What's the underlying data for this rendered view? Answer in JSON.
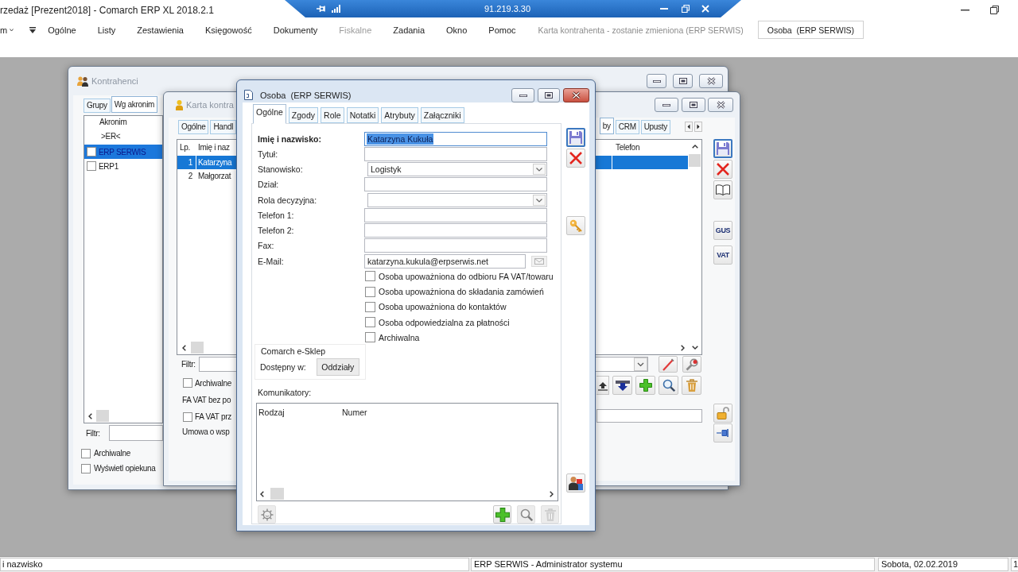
{
  "app": {
    "title": "rzedaż [Prezent2018] - Comarch ERP XL 2018.2.1"
  },
  "remote_bar": {
    "address": "91.219.3.30"
  },
  "menu_bar": {
    "start_menu": "m",
    "items": [
      {
        "label": "Ogólne",
        "disabled": false
      },
      {
        "label": "Listy",
        "disabled": false
      },
      {
        "label": "Zestawienia",
        "disabled": false
      },
      {
        "label": "Księgowość",
        "disabled": false
      },
      {
        "label": "Dokumenty",
        "disabled": false
      },
      {
        "label": "Fiskalne",
        "disabled": true
      },
      {
        "label": "Zadania",
        "disabled": false
      },
      {
        "label": "Okno",
        "disabled": false
      },
      {
        "label": "Pomoc",
        "disabled": false
      }
    ],
    "window_tabs": [
      {
        "label": "Karta kontrahenta - zostanie zmieniona (ERP SERWIS)",
        "selected": false
      },
      {
        "label": "Osoba  (ERP SERWIS)",
        "selected": true
      }
    ]
  },
  "contractors_window": {
    "title": "Kontrahenci",
    "active": false,
    "tabs": [
      {
        "label": "Grupy",
        "selected": false
      },
      {
        "label": "Wg akronim",
        "selected": true
      }
    ],
    "list": {
      "column": "Akronim",
      "filter": ">ER<",
      "rows": [
        {
          "label": "ERP SERWIS",
          "checked": false,
          "selected": true
        },
        {
          "label": "ERP1",
          "checked": false,
          "selected": false
        }
      ]
    },
    "filter_label": "Filtr:",
    "options": [
      {
        "label": "Archiwalne",
        "checked": false
      },
      {
        "label": "Wyświetl opiekuna",
        "checked": false
      }
    ]
  },
  "contractor_card_window": {
    "title": "Karta kontra",
    "active": false,
    "tabs_left": [
      {
        "label": "Ogólne",
        "selected": false
      },
      {
        "label": "Handl",
        "selected": false
      }
    ],
    "tabs_right": [
      {
        "label": "by",
        "selected": true
      },
      {
        "label": "CRM",
        "selected": false
      },
      {
        "label": "Upusty",
        "selected": false
      }
    ],
    "table": {
      "columns": [
        "Lp.",
        "Imię i naz",
        "Telefon"
      ],
      "rows": [
        {
          "number": "1",
          "name": "Katarzyna",
          "selected": true
        },
        {
          "number": "2",
          "name": "Małgorzat",
          "selected": false
        }
      ]
    },
    "filter_label": "Filtr:",
    "options": [
      {
        "kind": "checkbox",
        "label": "Archiwalne",
        "checked": false
      },
      {
        "kind": "text",
        "label": "FA VAT bez po"
      },
      {
        "kind": "checkbox",
        "label": "FA VAT prz",
        "checked": false
      },
      {
        "kind": "text",
        "label": "Umowa o wsp"
      }
    ],
    "lookup_buttons": [
      "GUS",
      "VAT"
    ]
  },
  "person_dialog": {
    "title": "Osoba  (ERP SERWIS)",
    "active": true,
    "tabs": [
      {
        "label": "Ogólne",
        "selected": true
      },
      {
        "label": "Zgody",
        "selected": false
      },
      {
        "label": "Role",
        "selected": false
      },
      {
        "label": "Notatki",
        "selected": false
      },
      {
        "label": "Atrybuty",
        "selected": false
      },
      {
        "label": "Załączniki",
        "selected": false
      }
    ],
    "fields": [
      {
        "label": "Imię i nazwisko:",
        "kind": "text",
        "required": true,
        "text_selected": true,
        "value": "Katarzyna Kukuła"
      },
      {
        "label": "Tytuł:",
        "kind": "text",
        "required": false,
        "text_selected": false
      },
      {
        "label": "Stanowisko:",
        "kind": "dropdown",
        "required": false,
        "text_selected": false,
        "value": "Logistyk"
      },
      {
        "label": "Dział:",
        "kind": "text",
        "required": false,
        "text_selected": false
      },
      {
        "label": "Rola decyzyjna:",
        "kind": "dropdown",
        "required": false,
        "text_selected": false
      },
      {
        "label": "Telefon 1:",
        "kind": "text",
        "required": false,
        "text_selected": false
      },
      {
        "label": "Telefon 2:",
        "kind": "text",
        "required": false,
        "text_selected": false
      },
      {
        "label": "Fax:",
        "kind": "text",
        "required": false,
        "text_selected": false
      },
      {
        "label": "E-Mail:",
        "kind": "email",
        "required": false,
        "text_selected": false,
        "value": "katarzyna.kukula@erpserwis.net"
      }
    ],
    "checkboxes": [
      {
        "label": "Osoba upoważniona do odbioru FA VAT/towaru",
        "checked": false
      },
      {
        "label": "Osoba upoważniona do składania zamówień",
        "checked": false
      },
      {
        "label": "Osoba upoważniona do kontaktów",
        "checked": false
      },
      {
        "label": "Osoba odpowiedzialna za płatności",
        "checked": false
      },
      {
        "label": "Archiwalna",
        "checked": false
      }
    ],
    "eshop": {
      "title": "Comarch e-Sklep",
      "label": "Dostępny w:",
      "button": "Oddziały"
    },
    "messengers": {
      "label": "Komunikatory:",
      "columns": [
        "Rodzaj",
        "Numer"
      ]
    }
  },
  "status_bar": {
    "hint": "i nazwisko",
    "user": "ERP SERWIS - Administrator systemu",
    "date": "Sobota, 02.02.2019",
    "extra_panel": "1"
  }
}
